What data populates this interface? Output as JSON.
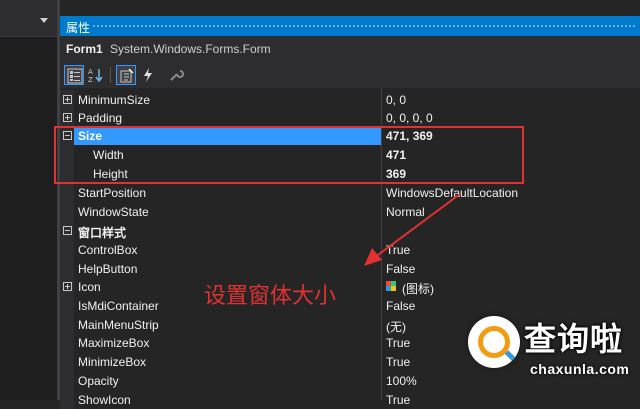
{
  "panel": {
    "title": "属性",
    "object_name": "Form1",
    "object_type": "System.Windows.Forms.Form"
  },
  "toolbar": {
    "buttons": [
      "categorized-icon",
      "alphabetical-icon",
      "properties-icon",
      "events-icon",
      "property-pages-icon"
    ]
  },
  "rows": [
    {
      "name": "MinimumSize",
      "value": "0, 0",
      "expander": "plus"
    },
    {
      "name": "Padding",
      "value": "0, 0, 0, 0",
      "expander": "plus"
    },
    {
      "name": "Size",
      "value": "471, 369",
      "expander": "minus",
      "selected": true
    },
    {
      "name": "Width",
      "value": "471"
    },
    {
      "name": "Height",
      "value": "369"
    },
    {
      "name": "StartPosition",
      "value": "WindowsDefaultLocation"
    },
    {
      "name": "WindowState",
      "value": "Normal"
    },
    {
      "name": "窗口样式",
      "value": "",
      "category": true
    },
    {
      "name": "ControlBox",
      "value": "True"
    },
    {
      "name": "HelpButton",
      "value": "False"
    },
    {
      "name": "Icon",
      "value": "(图标)",
      "expander": "plus"
    },
    {
      "name": "IsMdiContainer",
      "value": "False"
    },
    {
      "name": "MainMenuStrip",
      "value": "(无)"
    },
    {
      "name": "MaximizeBox",
      "value": "True"
    },
    {
      "name": "MinimizeBox",
      "value": "True"
    },
    {
      "name": "Opacity",
      "value": "100%"
    },
    {
      "name": "ShowIcon",
      "value": "True"
    }
  ],
  "annotation": {
    "text": "设置窗体大小",
    "color": "#e03232"
  },
  "watermark": {
    "title": "查询啦",
    "url": "chaxunla.com"
  },
  "colors": {
    "accent": "#007acc",
    "selection": "#3399ff",
    "background": "#252526"
  }
}
